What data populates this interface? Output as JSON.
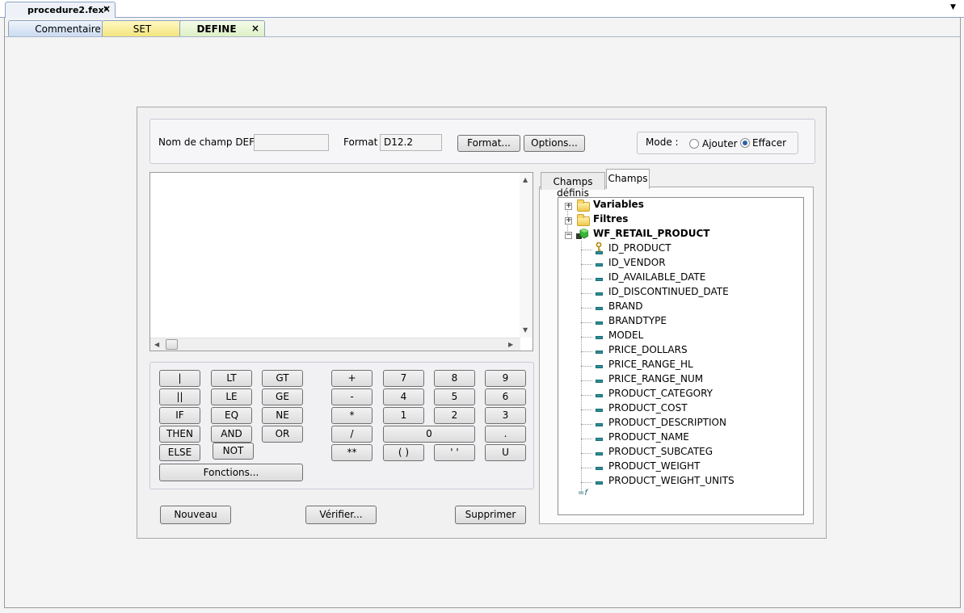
{
  "document_tab": {
    "title": "procedure2.fex*",
    "close": "×",
    "menu_arrow": "▼"
  },
  "sub_tabs": [
    {
      "label": "Commentaire",
      "color": "#c9daf0"
    },
    {
      "label": "SET",
      "color": "#f2e37a"
    },
    {
      "label": "DEFINE",
      "color": "#dcefc4",
      "close": "×"
    }
  ],
  "define_form": {
    "field_name_label": "Nom de champ DEFINE :",
    "field_name_value": "",
    "format_label": "Format :",
    "format_value": "D12.2",
    "format_button": "Format...",
    "options_button": "Options...",
    "mode_label": "Mode :",
    "mode_options": [
      {
        "label": "Ajouter",
        "selected": false
      },
      {
        "label": "Effacer",
        "selected": true
      }
    ]
  },
  "editor": {
    "content": ""
  },
  "keypad": {
    "operators": [
      [
        "|",
        "LT",
        "GT"
      ],
      [
        "||",
        "LE",
        "GE"
      ],
      [
        "IF",
        "EQ",
        "NE"
      ],
      [
        "THEN",
        "AND",
        "OR"
      ],
      [
        "ELSE",
        "NOT"
      ]
    ],
    "math": [
      [
        "+",
        "7",
        "8",
        "9"
      ],
      [
        "-",
        "4",
        "5",
        "6"
      ],
      [
        "*",
        "1",
        "2",
        "3"
      ],
      [
        "/",
        "0",
        "."
      ],
      [
        "**",
        "( )",
        "' '",
        "U"
      ]
    ],
    "functions_button": "Fonctions..."
  },
  "bottom_buttons": {
    "new": "Nouveau",
    "verify": "Vérifier...",
    "delete": "Supprimer"
  },
  "right_tabs": [
    {
      "label": "Champs définis",
      "active": false
    },
    {
      "label": "Champs",
      "active": true
    }
  ],
  "tree": {
    "folders": [
      "Variables",
      "Filtres"
    ],
    "table": "WF_RETAIL_PRODUCT",
    "fields": [
      "ID_PRODUCT",
      "ID_VENDOR",
      "ID_AVAILABLE_DATE",
      "ID_DISCONTINUED_DATE",
      "BRAND",
      "BRANDTYPE",
      "MODEL",
      "PRICE_DOLLARS",
      "PRICE_RANGE_HL",
      "PRICE_RANGE_NUM",
      "PRODUCT_CATEGORY",
      "PRODUCT_COST",
      "PRODUCT_DESCRIPTION",
      "PRODUCT_NAME",
      "PRODUCT_SUBCATEG",
      "PRODUCT_WEIGHT",
      "PRODUCT_WEIGHT_UNITS"
    ],
    "function_glyph": "=f"
  }
}
